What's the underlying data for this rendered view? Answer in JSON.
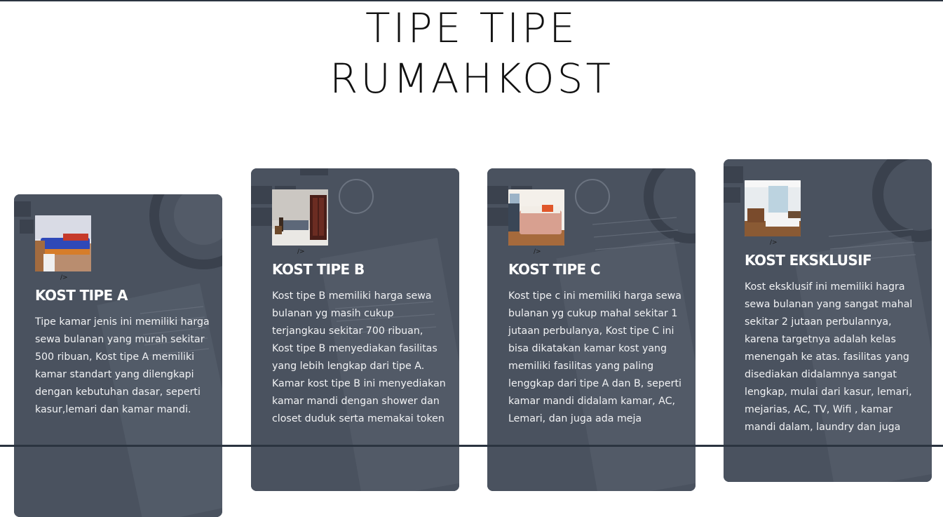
{
  "page": {
    "title_line1": "TIPE TIPE",
    "title_line2": "RUMAHKOST"
  },
  "colors": {
    "card_background": "#4b5361",
    "card_text": "#ffffff",
    "title_text": "#111111",
    "border": "#2b3440"
  },
  "cards": [
    {
      "icon": "room-photo-blue-bed",
      "stray": "/>",
      "title": "KOST TIPE A",
      "text": "Tipe kamar jenis ini memiliki harga sewa bulanan yang murah sekitar 500 ribuan, Kost tipe A memiliki kamar standart yang dilengkapi dengan kebutuhan dasar, seperti kasur,lemari dan kamar mandi."
    },
    {
      "icon": "room-photo-wardrobe",
      "stray": "/>",
      "title": "KOST TIPE B",
      "text": "Kost tipe B memiliki harga sewa bulanan yg masih cukup terjangkau sekitar 700 ribuan, Kost tipe B menyediakan fasilitas yang lebih lengkap dari tipe A. Kamar kost tipe B ini menyediakan kamar mandi dengan shower dan closet duduk serta memakai token"
    },
    {
      "icon": "room-photo-pink-bed",
      "stray": "/>",
      "title": "KOST TIPE C",
      "text": "Kost tipe c ini memiliki harga sewa bulanan yg cukup mahal sekitar 1 jutaan perbulanya, Kost tipe C ini bisa dikatakan kamar kost yang memiliki fasilitas yang paling lenggkap dari tipe A dan B, seperti kamar mandi didalam kamar, AC, Lemari, dan juga ada meja"
    },
    {
      "icon": "room-photo-modern-bedroom",
      "stray": "/>",
      "title": "KOST EKSKLUSIF",
      "text": "Kost eksklusif ini memiliki hagra sewa bulanan yang sangat mahal sekitar 2 jutaan perbulannya, karena targetnya adalah kelas menengah ke atas. fasilitas yang disediakan didalamnya sangat lengkap, mulai dari kasur, lemari, mejarias, AC, TV, Wifi , kamar mandi dalam, laundry dan juga"
    }
  ]
}
